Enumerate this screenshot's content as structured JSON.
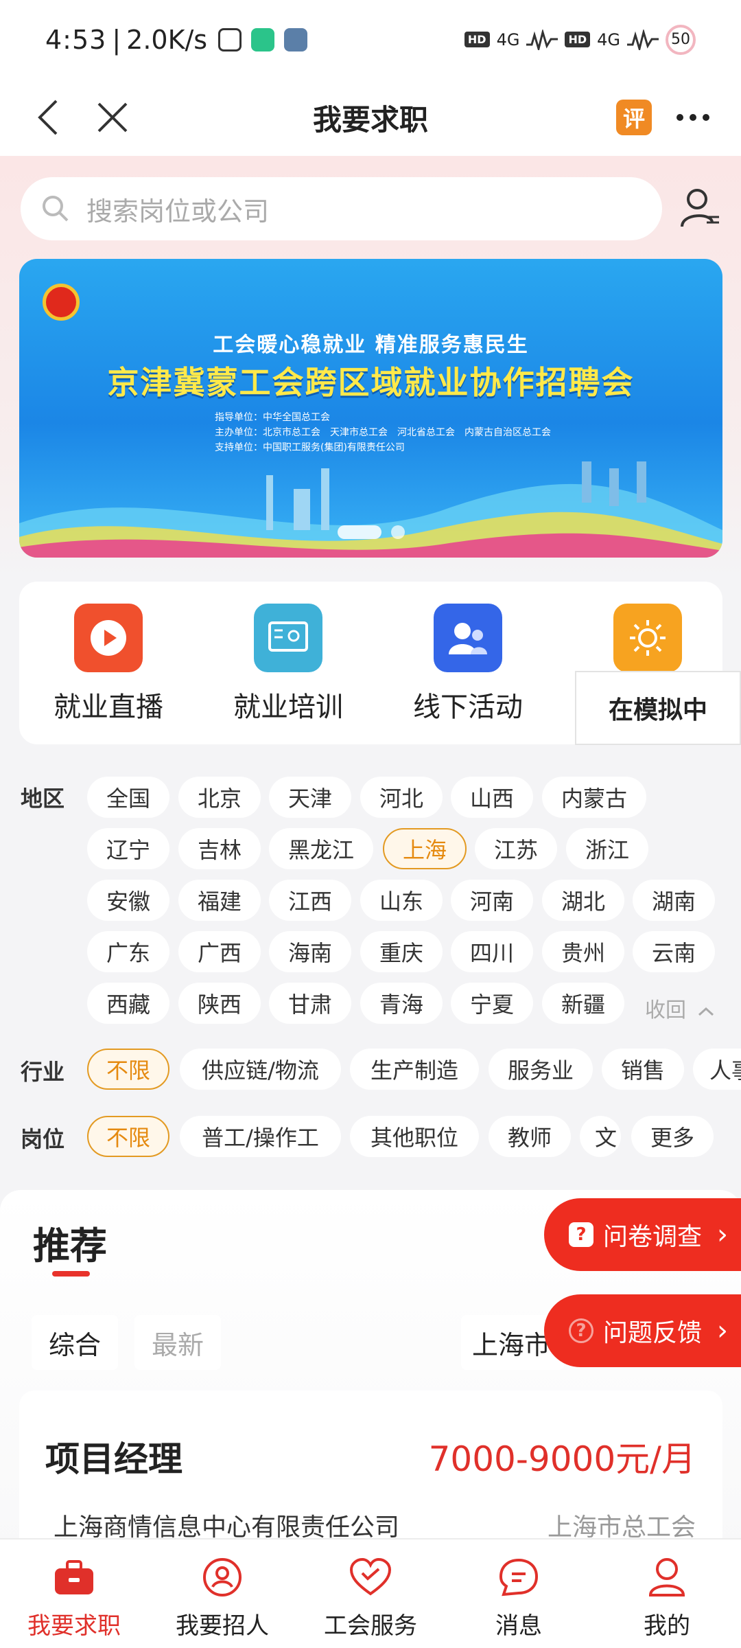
{
  "status_bar": {
    "time": "4:53",
    "speed": "2.0K/s",
    "signal_label_1": "4G",
    "signal_label_2": "4G",
    "hd_1": "HD",
    "hd_2": "HD",
    "battery": "50"
  },
  "nav": {
    "title": "我要求职",
    "review_badge": "评"
  },
  "search": {
    "placeholder": "搜索岗位或公司"
  },
  "banner": {
    "line1": "工会暖心稳就业  精准服务惠民生",
    "line2": "京津冀蒙工会跨区域就业协作招聘会",
    "guide": "指导单位：中华全国总工会",
    "host": "主办单位：北京市总工会　天津市总工会　河北省总工会　内蒙古自治区总工会",
    "support": "支持单位：中国职工服务(集团)有限责任公司"
  },
  "quick_menu": [
    {
      "label": "就业直播",
      "color": "#f0502d",
      "icon": "play-icon"
    },
    {
      "label": "就业培训",
      "color": "#3fb1d8",
      "icon": "training-icon"
    },
    {
      "label": "线下活动",
      "color": "#3466e8",
      "icon": "people-icon"
    },
    {
      "label": "",
      "color": "#f7a320",
      "icon": "sun-icon"
    }
  ],
  "sim_toast": "在模拟中",
  "filters": {
    "region_label": "地区",
    "regions": [
      "全国",
      "北京",
      "天津",
      "河北",
      "山西",
      "内蒙古",
      "辽宁",
      "吉林",
      "黑龙江",
      "上海",
      "江苏",
      "浙江",
      "安徽",
      "福建",
      "江西",
      "山东",
      "河南",
      "湖北",
      "湖南",
      "广东",
      "广西",
      "海南",
      "重庆",
      "四川",
      "贵州",
      "云南",
      "西藏",
      "陕西",
      "甘肃",
      "青海",
      "宁夏",
      "新疆"
    ],
    "selected_region": "上海",
    "collapse": "收回",
    "industry_label": "行业",
    "industries": [
      "不限",
      "供应链/物流",
      "生产制造",
      "服务业",
      "销售",
      "人事"
    ],
    "position_label": "岗位",
    "positions": [
      "不限",
      "普工/操作工",
      "其他职位",
      "教师",
      "文"
    ],
    "more": "更多"
  },
  "recommend": {
    "title": "推荐",
    "sort_all": "综合",
    "sort_new": "最新",
    "city": "上海市",
    "survey": "问卷调查",
    "feedback": "问题反馈"
  },
  "job": {
    "title": "项目经理",
    "salary": "7000-9000元/月",
    "company": "上海商情信息中心有限责任公司",
    "union": "上海市总工会"
  },
  "tabs": [
    {
      "label": "我要求职",
      "icon": "briefcase-icon"
    },
    {
      "label": "我要招人",
      "icon": "recruit-icon"
    },
    {
      "label": "工会服务",
      "icon": "heart-icon"
    },
    {
      "label": "消息",
      "icon": "message-icon"
    },
    {
      "label": "我的",
      "icon": "profile-icon"
    }
  ],
  "colors": {
    "accent": "#e0302a",
    "selected_chip": "#e58a10"
  }
}
